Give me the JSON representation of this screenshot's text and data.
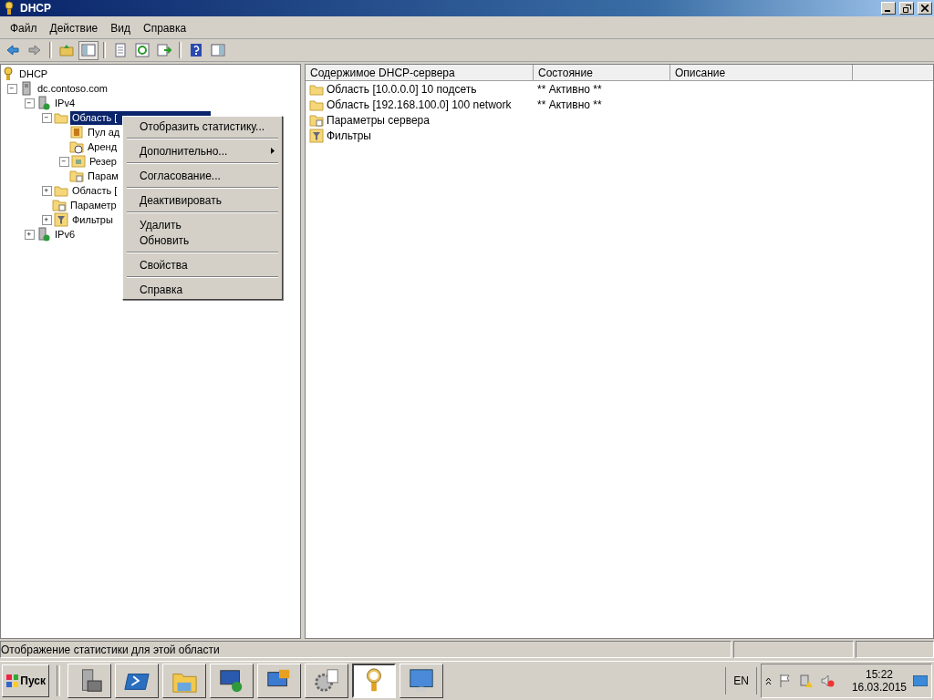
{
  "window": {
    "title": "DHCP"
  },
  "menu_bar": [
    "Файл",
    "Действие",
    "Вид",
    "Справка"
  ],
  "toolbar": [
    {
      "kind": "back"
    },
    {
      "kind": "forward"
    },
    {
      "kind": "sep"
    },
    {
      "kind": "up"
    },
    {
      "kind": "tree",
      "selected": true
    },
    {
      "kind": "sep"
    },
    {
      "kind": "export"
    },
    {
      "kind": "refresh"
    },
    {
      "kind": "list"
    },
    {
      "kind": "sep"
    },
    {
      "kind": "help"
    },
    {
      "kind": "panel",
      "selected": false
    }
  ],
  "tree": [
    {
      "label": "DHCP",
      "kind": "dhcp",
      "selected": false,
      "children": [
        {
          "label": "dc.contoso.com",
          "kind": "server",
          "expanded": true,
          "selected": false,
          "children": [
            {
              "label": "IPv4",
              "kind": "ipv",
              "expanded": true,
              "selected": false,
              "children": [
                {
                  "label": "Область [",
                  "kind": "folder",
                  "expanded": true,
                  "selected": true,
                  "children": [
                    {
                      "label": "Пул ад",
                      "kind": "pool",
                      "selected": false
                    },
                    {
                      "label": "Аренд",
                      "kind": "lease",
                      "selected": false
                    },
                    {
                      "label": "Резер",
                      "kind": "reserve",
                      "expanded": true,
                      "selected": false
                    },
                    {
                      "label": "Парам",
                      "kind": "options",
                      "selected": false
                    }
                  ]
                },
                {
                  "label": "Область [",
                  "kind": "folder",
                  "expanded": false,
                  "selected": false
                },
                {
                  "label": "Параметр",
                  "kind": "options",
                  "selected": false
                },
                {
                  "label": "Фильтры",
                  "kind": "filter",
                  "expanded": false,
                  "selected": false
                }
              ]
            },
            {
              "label": "IPv6",
              "kind": "ipv",
              "expanded": false,
              "selected": false
            }
          ]
        }
      ]
    }
  ],
  "context_menu": {
    "groups": [
      [
        {
          "label": "Отобразить статистику..."
        }
      ],
      [
        {
          "label": "Дополнительно...",
          "submenu": true
        }
      ],
      [
        {
          "label": "Согласование..."
        }
      ],
      [
        {
          "label": "Деактивировать"
        }
      ],
      [
        {
          "label": "Удалить"
        },
        {
          "label": "Обновить"
        }
      ],
      [
        {
          "label": "Свойства"
        }
      ],
      [
        {
          "label": "Справка"
        }
      ]
    ]
  },
  "table": {
    "columns": [
      "Содержимое DHCP-сервера",
      "Состояние",
      "Описание"
    ],
    "rows": [
      {
        "kind": "folder",
        "name": "Область [10.0.0.0] 10 подсеть",
        "status": "** Активно **"
      },
      {
        "kind": "folder",
        "name": "Область [192.168.100.0] 100 network",
        "status": "** Активно **"
      },
      {
        "kind": "options",
        "name": "Параметры сервера"
      },
      {
        "kind": "filter",
        "name": "Фильтры"
      }
    ]
  },
  "status_bar": "Отображение статистики для этой области",
  "taskbar": {
    "start": "Пуск",
    "apps": [
      {
        "kind": "server-manager",
        "selected": false
      },
      {
        "kind": "powershell",
        "selected": false
      },
      {
        "kind": "explorer",
        "selected": false
      },
      {
        "kind": "remote",
        "selected": false
      },
      {
        "kind": "update",
        "selected": false
      },
      {
        "kind": "settings",
        "selected": false
      },
      {
        "kind": "dhcp",
        "selected": true
      },
      {
        "kind": "control",
        "selected": false
      }
    ],
    "language": "EN",
    "time": "15:22",
    "date": "16.03.2015"
  }
}
